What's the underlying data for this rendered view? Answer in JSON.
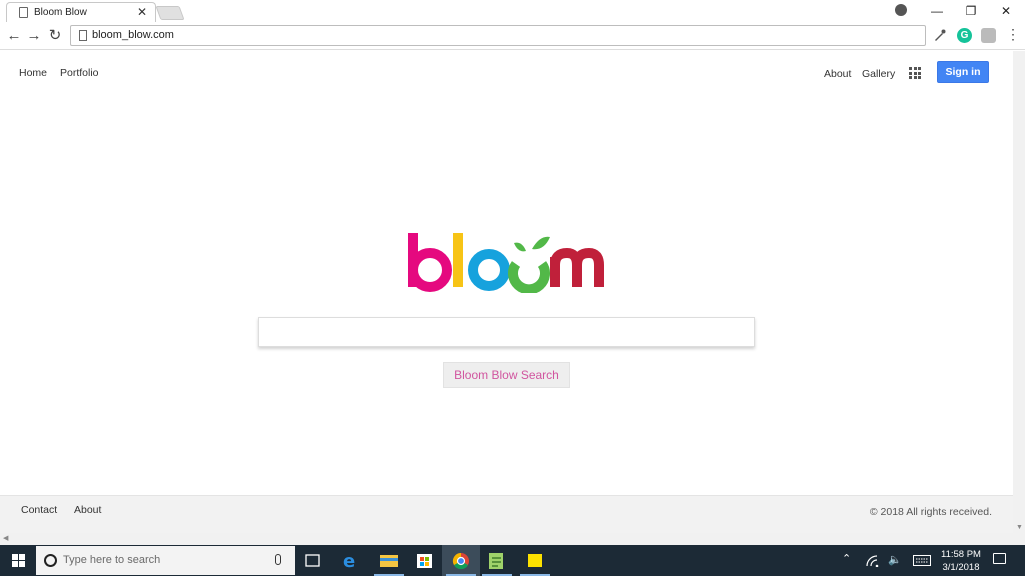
{
  "browser": {
    "tab_title": "Bloom Blow",
    "tab_close": "✕",
    "url": "bloom_blow.com",
    "window_min": "—",
    "window_restore": "❐",
    "window_close": "✕",
    "grammarly_letter": "G"
  },
  "nav": {
    "left": [
      "Home",
      "Portfolio"
    ],
    "right": [
      "About",
      "Gallery"
    ],
    "signin_label": "Sign in"
  },
  "logo": {
    "text": "bloom",
    "colors": {
      "b": "#e5097f",
      "l": "#f7c416",
      "o1": "#16a2dd",
      "o2": "#52b848",
      "m": "#c0203a",
      "leaf": "#52b848"
    }
  },
  "search": {
    "value": "",
    "button_label": "Bloom Blow Search"
  },
  "footer": {
    "links": [
      "Contact",
      "About"
    ],
    "copyright": "© 2018 All rights received."
  },
  "taskbar": {
    "search_placeholder": "Type here to search",
    "time": "11:58 PM",
    "date": "3/1/2018",
    "pinned": [
      "task-view-icon",
      "edge-icon",
      "file-explorer-icon",
      "store-icon",
      "chrome-icon",
      "notepad-plus-icon",
      "sticky-notes-icon"
    ]
  }
}
